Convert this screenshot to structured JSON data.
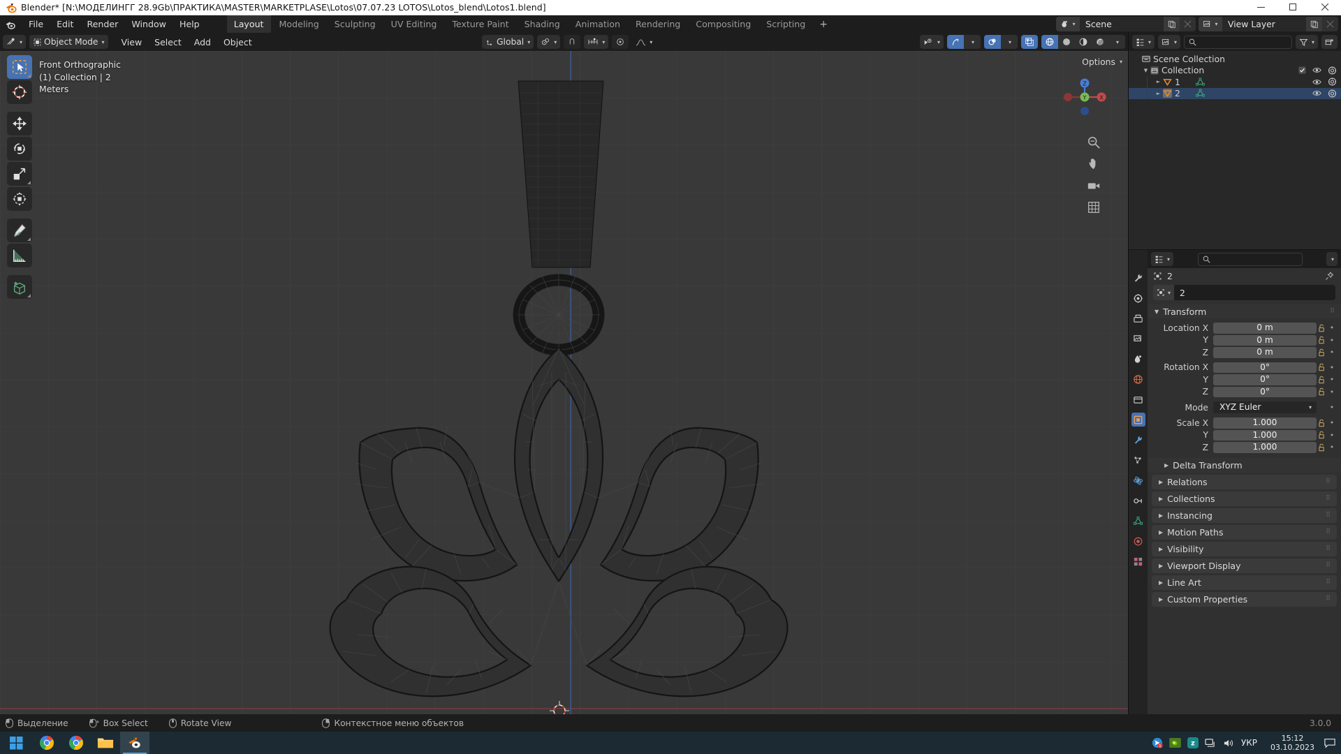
{
  "window": {
    "title": "Blender* [N:\\МОДЕЛИНГГ 28.9Gb\\ПРАКТИКА\\MASTER\\MARKETPLASE\\Lotos\\07.07.23 LOTOS\\Lotos_blend\\Lotos1.blend]",
    "minimize": "minimize-icon",
    "maximize": "maximize-icon",
    "close": "close-icon"
  },
  "topbar": {
    "menus": [
      "File",
      "Edit",
      "Render",
      "Window",
      "Help"
    ],
    "workspaces": [
      {
        "label": "Layout",
        "active": true
      },
      {
        "label": "Modeling",
        "active": false
      },
      {
        "label": "Sculpting",
        "active": false
      },
      {
        "label": "UV Editing",
        "active": false
      },
      {
        "label": "Texture Paint",
        "active": false
      },
      {
        "label": "Shading",
        "active": false
      },
      {
        "label": "Animation",
        "active": false
      },
      {
        "label": "Rendering",
        "active": false
      },
      {
        "label": "Compositing",
        "active": false
      },
      {
        "label": "Scripting",
        "active": false
      }
    ],
    "add_workspace": "+",
    "scene_name": "Scene",
    "viewlayer_name": "View Layer"
  },
  "viewport_header": {
    "mode": "Object Mode",
    "menus": [
      "View",
      "Select",
      "Add",
      "Object"
    ],
    "transform_orientation": "Global",
    "options_label": "Options"
  },
  "viewport": {
    "info_line1": "Front Orthographic",
    "info_line2": "(1) Collection | 2",
    "info_line3": "Meters",
    "gizmo_axes": [
      "Z",
      "Y",
      "X"
    ]
  },
  "outliner": {
    "rows": [
      {
        "label": "Scene Collection",
        "depth": 0,
        "icon": "collection-icon",
        "selected": false,
        "expand": "",
        "checkbox": false,
        "eye": false,
        "camera": false
      },
      {
        "label": "Collection",
        "depth": 1,
        "icon": "collection-icon",
        "selected": false,
        "expand": "▼",
        "checkbox": true,
        "eye": true,
        "camera": true
      },
      {
        "label": "1",
        "depth": 2,
        "icon": "mesh-object-icon",
        "selected": false,
        "expand": "►",
        "checkbox": false,
        "eye": true,
        "camera": true
      },
      {
        "label": "2",
        "depth": 2,
        "icon": "mesh-object-icon",
        "selected": true,
        "expand": "►",
        "checkbox": false,
        "eye": true,
        "camera": true
      }
    ]
  },
  "properties": {
    "breadcrumb_object": "2",
    "id_name": "2",
    "transform": {
      "title": "Transform",
      "rows": [
        {
          "label": "Location X",
          "value": "0 m",
          "lock": true
        },
        {
          "label": "Y",
          "value": "0 m",
          "lock": true
        },
        {
          "label": "Z",
          "value": "0 m",
          "lock": true
        },
        {
          "label": "Rotation X",
          "value": "0°",
          "lock": true
        },
        {
          "label": "Y",
          "value": "0°",
          "lock": true
        },
        {
          "label": "Z",
          "value": "0°",
          "lock": true
        }
      ],
      "mode_label": "Mode",
      "mode_value": "XYZ Euler",
      "scale_rows": [
        {
          "label": "Scale X",
          "value": "1.000",
          "lock": true
        },
        {
          "label": "Y",
          "value": "1.000",
          "lock": true
        },
        {
          "label": "Z",
          "value": "1.000",
          "lock": true
        }
      ]
    },
    "delta_transform": "Delta Transform",
    "closed_panels": [
      "Relations",
      "Collections",
      "Instancing",
      "Motion Paths",
      "Visibility",
      "Viewport Display",
      "Line Art",
      "Custom Properties"
    ]
  },
  "statusbar": {
    "items": [
      {
        "icon": "mouse-left-icon",
        "label": "Выделение"
      },
      {
        "icon": "mouse-drag-icon",
        "label": "Box Select"
      },
      {
        "icon": "mouse-middle-icon",
        "label": "Rotate View"
      },
      {
        "icon": "mouse-right-icon",
        "label": "Контекстное меню объектов"
      }
    ],
    "version": "3.0.0"
  },
  "taskbar": {
    "start": "windows-start-icon",
    "apps": [
      "chrome-icon",
      "chrome-icon-2",
      "file-explorer-icon",
      "blender-icon"
    ],
    "tray": [
      "notification-icon",
      "nvidia-icon",
      "zoom-icon",
      "network-icon",
      "volume-icon"
    ],
    "language": "УКР",
    "time": "15:12",
    "date": "03.10.2023",
    "notification": "action-center-icon"
  },
  "colors": {
    "accent_blue": "#4772b3",
    "viewport_bg": "#393939",
    "panel_bg": "#303030",
    "header_bg": "#1d1d1d",
    "outliner_bg": "#282828",
    "axis_z": "#4a7dd1",
    "axis_x": "#c44a4a",
    "mesh_orange": "#e8922f",
    "taskbar_bg": "#1b2a33"
  }
}
